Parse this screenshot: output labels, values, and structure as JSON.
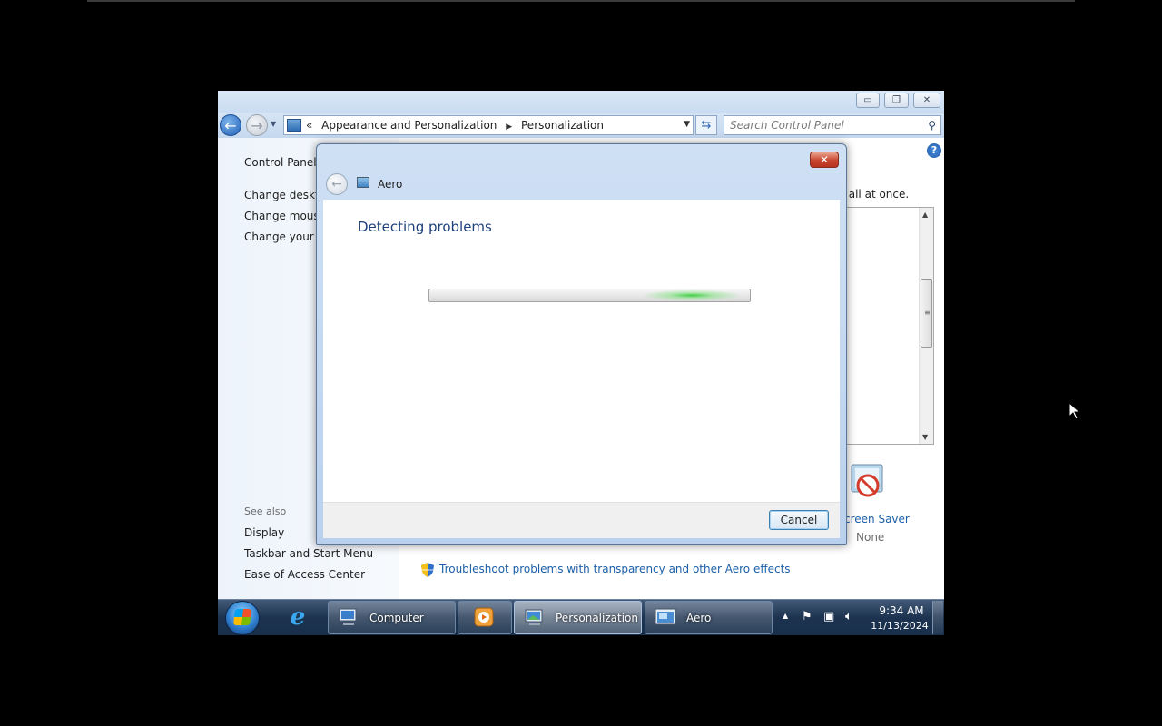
{
  "control_panel": {
    "address_breadcrumb": [
      "Appearance and Personalization",
      "Personalization"
    ],
    "address_prefix": "«",
    "search_placeholder": "Search Control Panel",
    "sidebar": {
      "home_link": "Control Panel H",
      "links": [
        "Change deskto",
        "Change mouse",
        "Change your ac"
      ],
      "see_also_header": "See also",
      "see_also_links": [
        "Display",
        "Taskbar and Start Menu",
        "Ease of Access Center"
      ]
    },
    "intro_text_tail": "r all at once.",
    "screen_saver": {
      "label": "creen Saver",
      "value": "None"
    },
    "troubleshoot_link": "Troubleshoot problems with transparency and other Aero effects"
  },
  "dialog": {
    "title": "Aero",
    "heading": "Detecting problems",
    "progress_glow_position": 0.82,
    "cancel_label": "Cancel"
  },
  "taskbar": {
    "buttons": [
      {
        "label": "Computer",
        "icon": "computer-icon",
        "active": false
      },
      {
        "label": "",
        "icon": "media-player-icon",
        "active": false
      },
      {
        "label": "Personalization",
        "icon": "personalization-icon",
        "active": true
      },
      {
        "label": "Aero",
        "icon": "aero-icon",
        "active": false
      }
    ],
    "clock_time": "9:34 AM",
    "clock_date": "11/13/2024"
  },
  "colors": {
    "link": "#1c5fa8",
    "heading": "#1e3f7a",
    "progress_glow": "#38cd3c",
    "close_button": "#c8442c",
    "taskbar": "#1d3350"
  }
}
